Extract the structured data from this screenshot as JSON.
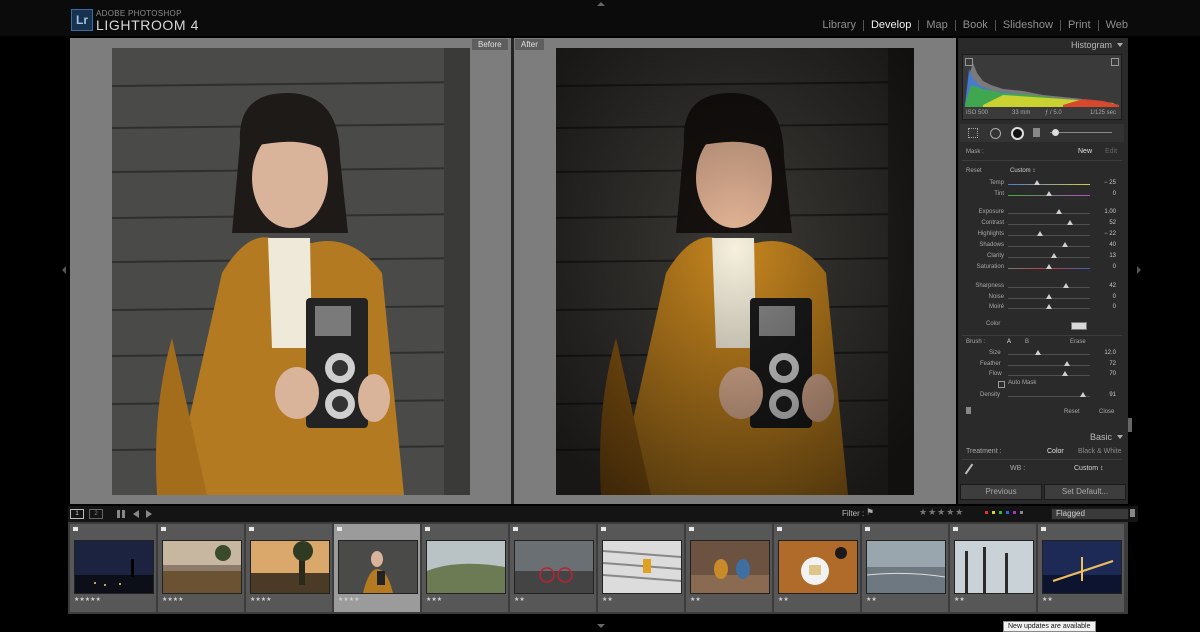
{
  "app": {
    "logo": "Lr",
    "brand_small": "ADOBE PHOTOSHOP",
    "brand_big": "LIGHTROOM 4"
  },
  "modules": [
    "Library",
    "Develop",
    "Map",
    "Book",
    "Slideshow",
    "Print",
    "Web"
  ],
  "active_module": "Develop",
  "viewer": {
    "before_label": "Before",
    "after_label": "After"
  },
  "histogram": {
    "title": "Histogram",
    "iso": "ISO 500",
    "focal": "33 mm",
    "aperture": "ƒ / 5.0",
    "shutter": "1/125 sec"
  },
  "mask": {
    "label": "Mask :",
    "new_label": "New",
    "edit_label": "Edit",
    "reset_label": "Reset",
    "preset": "Custom ↕"
  },
  "sliders": [
    {
      "label": "Temp",
      "value": "− 25",
      "level": 0.35
    },
    {
      "label": "Tint",
      "value": "0",
      "level": 0.5
    },
    {
      "label": "Exposure",
      "value": "1.00",
      "level": 0.62
    },
    {
      "label": "Contrast",
      "value": "52",
      "level": 0.76
    },
    {
      "label": "Highlights",
      "value": "− 22",
      "level": 0.39
    },
    {
      "label": "Shadows",
      "value": "40",
      "level": 0.7
    },
    {
      "label": "Clarity",
      "value": "13",
      "level": 0.56
    },
    {
      "label": "Saturation",
      "value": "0",
      "level": 0.5
    },
    {
      "label": "Sharpness",
      "value": "42",
      "level": 0.71
    },
    {
      "label": "Noise",
      "value": "0",
      "level": 0.5
    },
    {
      "label": "Moiré",
      "value": "0",
      "level": 0.5
    }
  ],
  "color_label": "Color",
  "brush": {
    "label": "Brush :",
    "a": "A",
    "b": "B",
    "erase": "Erase",
    "size_label": "Size",
    "size_value": "12.0",
    "size_level": 0.37,
    "feather_label": "Feather",
    "feather_value": "72",
    "feather_level": 0.72,
    "flow_label": "Flow",
    "flow_value": "70",
    "flow_level": 0.7,
    "automask_label": "Auto Mask",
    "density_label": "Density",
    "density_value": "91",
    "density_level": 0.91,
    "reset_label": "Reset",
    "close_label": "Close"
  },
  "basic": {
    "title": "Basic",
    "treatment_label": "Treatment :",
    "color_option": "Color",
    "bw_option": "Black & White",
    "wb_label": "WB :",
    "wb_value": "Custom ↕"
  },
  "buttons": {
    "previous": "Previous",
    "set_default": "Set Default..."
  },
  "filmbar": {
    "page1": "1",
    "page2": "2",
    "filter_label": "Filter :",
    "filter_value": "Flagged",
    "stars": "★★★★★"
  },
  "filmstrip": [
    {
      "stars": "★★★★★",
      "theme": "night"
    },
    {
      "stars": "★★★★",
      "theme": "dusk"
    },
    {
      "stars": "★★★★",
      "theme": "sunset"
    },
    {
      "stars": "★★★★",
      "theme": "portrait"
    },
    {
      "stars": "★★★",
      "theme": "fog"
    },
    {
      "stars": "★★",
      "theme": "street"
    },
    {
      "stars": "★★",
      "theme": "stairs"
    },
    {
      "stars": "★★",
      "theme": "cafe"
    },
    {
      "stars": "★★",
      "theme": "food"
    },
    {
      "stars": "★★",
      "theme": "beach"
    },
    {
      "stars": "★★",
      "theme": "trees"
    },
    {
      "stars": "★★",
      "theme": "bridge"
    }
  ],
  "tooltip": "New updates are available",
  "colors": {
    "mustard": "#b37a22",
    "wood": "#4b4c4a",
    "panel": "#2a2a2a",
    "accent_blue": "#3b6ea5"
  }
}
